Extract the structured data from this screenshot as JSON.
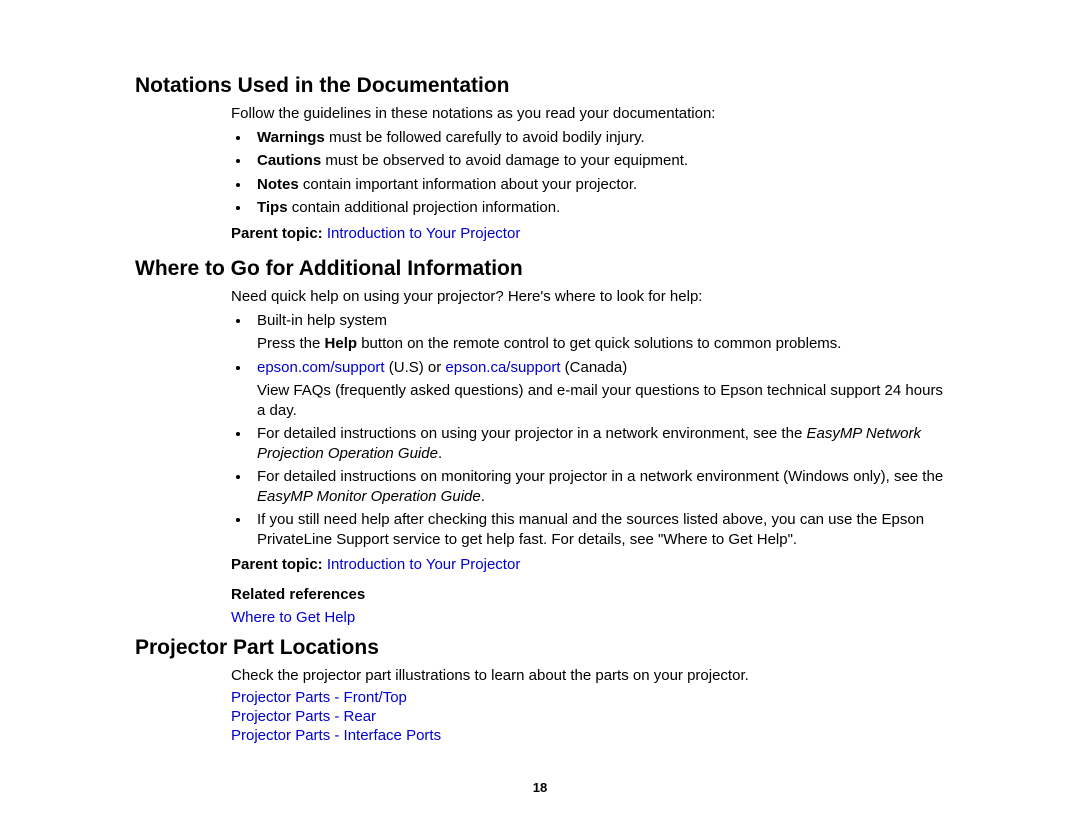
{
  "section1": {
    "heading": "Notations Used in the Documentation",
    "intro": "Follow the guidelines in these notations as you read your documentation:",
    "bullets": [
      {
        "bold": "Warnings",
        "rest": " must be followed carefully to avoid bodily injury."
      },
      {
        "bold": "Cautions",
        "rest": " must be observed to avoid damage to your equipment."
      },
      {
        "bold": "Notes",
        "rest": " contain important information about your projector."
      },
      {
        "bold": "Tips",
        "rest": " contain additional projection information."
      }
    ],
    "parent_topic_label": "Parent topic: ",
    "parent_topic_link": "Introduction to Your Projector"
  },
  "section2": {
    "heading": "Where to Go for Additional Information",
    "intro": "Need quick help on using your projector? Here's where to look for help:",
    "bullet1": "Built-in help system",
    "bullet1_sub_pre": "Press the ",
    "bullet1_sub_bold": "Help",
    "bullet1_sub_post": " button on the remote control to get quick solutions to common problems.",
    "bullet2_link1": "epson.com/support",
    "bullet2_mid": " (U.S) or ",
    "bullet2_link2": "epson.ca/support",
    "bullet2_end": " (Canada)",
    "bullet2_sub": "View FAQs (frequently asked questions) and e-mail your questions to Epson technical support 24 hours a day.",
    "bullet3_pre": "For detailed instructions on using your projector in a network environment, see the ",
    "bullet3_italic": "EasyMP Network Projection Operation Guide",
    "bullet3_post": ".",
    "bullet4_pre": "For detailed instructions on monitoring your projector in a network environment (Windows only), see the ",
    "bullet4_italic": "EasyMP Monitor Operation Guide",
    "bullet4_post": ".",
    "bullet5": "If you still need help after checking this manual and the sources listed above, you can use the Epson PrivateLine Support service to get help fast. For details, see \"Where to Get Help\".",
    "parent_topic_label": "Parent topic: ",
    "parent_topic_link": "Introduction to Your Projector",
    "related_references_label": "Related references",
    "related_ref_link": "Where to Get Help"
  },
  "section3": {
    "heading": "Projector Part Locations",
    "intro": "Check the projector part illustrations to learn about the parts on your projector.",
    "links": [
      "Projector Parts - Front/Top",
      "Projector Parts - Rear",
      "Projector Parts - Interface Ports"
    ]
  },
  "page_number": "18"
}
